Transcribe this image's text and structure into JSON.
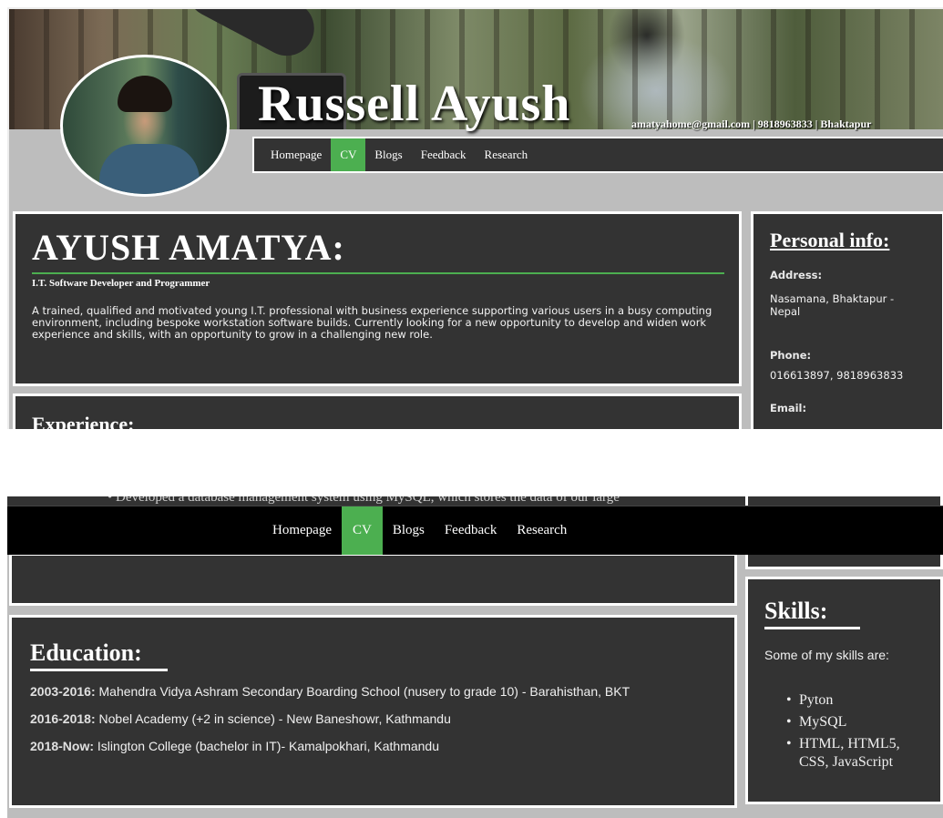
{
  "header": {
    "site_title": "Russell Ayush",
    "contact": "amatyahome@gmail.com | 9818963833 | Bhaktapur"
  },
  "nav": {
    "items": [
      {
        "label": "Homepage",
        "active": false
      },
      {
        "label": "CV",
        "active": true
      },
      {
        "label": "Blogs",
        "active": false
      },
      {
        "label": "Feedback",
        "active": false
      },
      {
        "label": "Research",
        "active": false
      }
    ],
    "active_color": "#4caf50"
  },
  "intro": {
    "name": "AYUSH AMATYA:",
    "role": "I.T. Software Developer and Programmer",
    "summary": "A trained, qualified and motivated young I.T. professional with business experience supporting various users in a busy computing environment, including bespoke workstation software builds. Currently looking for a new opportunity to develop and widen work experience and skills, with an opportunity to grow in a challenging new role."
  },
  "experience": {
    "heading": "Experience:",
    "partial_text": "• Developed a database management system using MySQL, which stores the data of our large"
  },
  "personal_info": {
    "heading": "Personal info:",
    "address_label": "Address:",
    "address_value": "Nasamana, Bhaktapur - Nepal",
    "phone_label": "Phone:",
    "phone_value": "016613897, 9818963833",
    "email_label": "Email:"
  },
  "education": {
    "heading": "Education:",
    "rows": [
      {
        "years": "2003-2016:",
        "text": "Mahendra Vidya Ashram Secondary Boarding School (nusery to grade 10) - Barahisthan, BKT"
      },
      {
        "years": "2016-2018:",
        "text": "Nobel Academy (+2 in science) - New Baneshowr, Kathmandu"
      },
      {
        "years": "2018-Now:",
        "text": "Islington College (bachelor in IT)- Kamalpokhari, Kathmandu"
      }
    ]
  },
  "skills": {
    "heading": "Skills:",
    "intro": "Some of my skills are:",
    "items": [
      "Pyton",
      "MySQL",
      "HTML, HTML5, CSS, JavaScript"
    ]
  }
}
